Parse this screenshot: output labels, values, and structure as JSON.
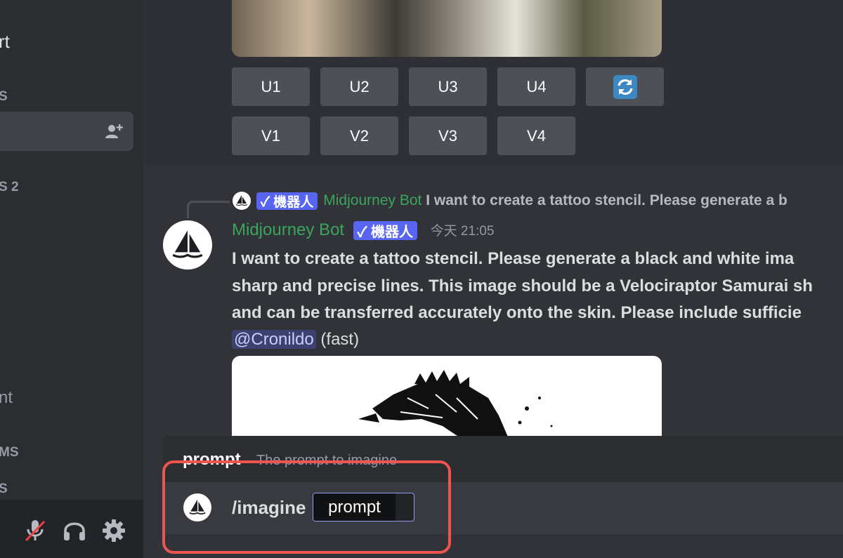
{
  "sidebar": {
    "partial_texts": [
      "rt",
      "S",
      "S 2",
      "nt",
      "MS",
      "S"
    ],
    "icons": [
      "add-user-icon",
      "mute-mic-icon",
      "headphones-icon",
      "gear-icon"
    ]
  },
  "upscale_buttons": [
    "U1",
    "U2",
    "U3",
    "U4"
  ],
  "variation_buttons": [
    "V1",
    "V2",
    "V3",
    "V4"
  ],
  "reroll_icon": "refresh-icon",
  "reply": {
    "badge": "✓ 機器人",
    "author": "Midjourney Bot",
    "text": "I want to create a tattoo stencil. Please generate a b"
  },
  "message": {
    "author": "Midjourney Bot",
    "badge": "✓ 機器人",
    "timestamp": "今天 21:05",
    "lines": [
      "I want to create a tattoo stencil. Please generate a black and white ima",
      "sharp and precise lines. This image should be a Velociraptor Samurai sh",
      "and can be transferred accurately onto the skin. Please include sufficie"
    ],
    "mention": "@Cronildo",
    "suffix": "(fast)"
  },
  "autocomplete": {
    "option_name": "prompt",
    "option_description": "The prompt to imagine"
  },
  "command": {
    "name": "/imagine",
    "param": "prompt"
  },
  "colors": {
    "accent": "#5865f2",
    "bot_name": "#3ba55c",
    "highlight": "#ef5451"
  }
}
